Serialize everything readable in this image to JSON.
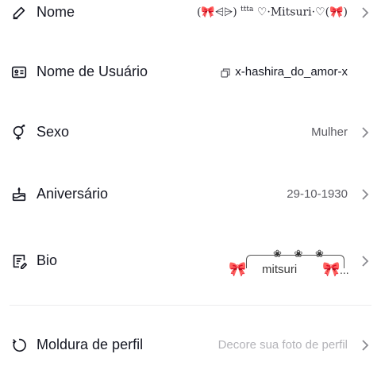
{
  "fields": {
    "name": {
      "label": "Nome",
      "value_prefix": "(🎀⩤⩥)",
      "value_sup": "ttta",
      "value_main": "♡·Mitsuri·♡(🎀)"
    },
    "username": {
      "label": "Nome de Usuário",
      "value": "x-hashira_do_amor-x"
    },
    "gender": {
      "label": "Sexo",
      "value": "Mulher"
    },
    "birthday": {
      "label": "Aniversário",
      "value": "29-10-1930"
    },
    "bio": {
      "label": "Bio",
      "flowers": "❀ ❀ ❀",
      "bow_left": "🎀",
      "name": "mitsuri",
      "bow_right": "🎀",
      "ellipsis": "..."
    },
    "frame": {
      "label": "Moldura de perfil",
      "placeholder": "Decore sua foto de perfil"
    }
  },
  "colors": {
    "text": "#161823",
    "secondary": "#5c5c63",
    "placeholder": "#b3b3b8",
    "divider": "#ececee",
    "bow": "#e86b8a"
  }
}
